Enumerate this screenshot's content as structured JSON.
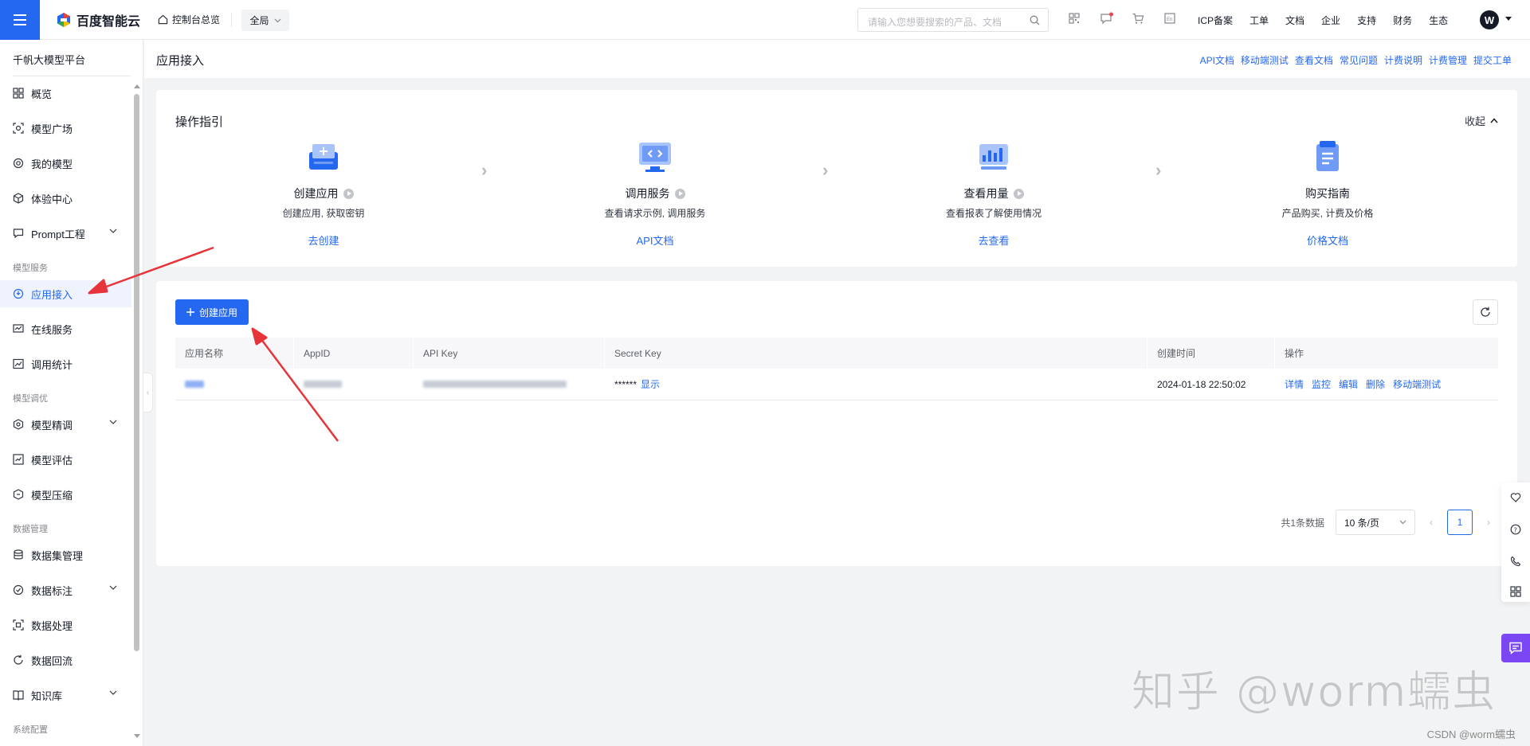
{
  "header": {
    "logo_text": "百度智能云",
    "console_home": "控制台总览",
    "region": "全局",
    "search_placeholder": "请输入您想要搜索的产品、文档",
    "links": [
      "ICP备案",
      "工单",
      "文档",
      "企业",
      "支持",
      "财务",
      "生态"
    ],
    "avatar_letter": "W",
    "brand_color": "#2468f2"
  },
  "sidebar": {
    "title": "千帆大模型平台",
    "items": [
      {
        "label": "概览",
        "icon": "grid-icon"
      },
      {
        "label": "模型广场",
        "icon": "model-square-icon"
      },
      {
        "label": "我的模型",
        "icon": "my-model-icon"
      },
      {
        "label": "体验中心",
        "icon": "cube-icon"
      },
      {
        "label": "Prompt工程",
        "icon": "prompt-icon"
      },
      {
        "label": "应用接入",
        "icon": "app-access-icon"
      },
      {
        "label": "在线服务",
        "icon": "online-service-icon"
      },
      {
        "label": "调用统计",
        "icon": "stats-icon"
      },
      {
        "label": "模型精调",
        "icon": "finetune-icon"
      },
      {
        "label": "模型评估",
        "icon": "evaluate-icon"
      },
      {
        "label": "模型压缩",
        "icon": "compress-icon"
      },
      {
        "label": "数据集管理",
        "icon": "database-icon"
      },
      {
        "label": "数据标注",
        "icon": "annotate-icon"
      },
      {
        "label": "数据处理",
        "icon": "process-icon"
      },
      {
        "label": "数据回流",
        "icon": "reflow-icon"
      },
      {
        "label": "知识库",
        "icon": "knowledge-icon"
      }
    ],
    "groups": [
      "模型服务",
      "模型调优",
      "数据管理",
      "系统配置"
    ]
  },
  "page": {
    "title": "应用接入",
    "head_links": [
      "API文档",
      "移动端测试",
      "查看文档",
      "常见问题",
      "计费说明",
      "计费管理",
      "提交工单"
    ]
  },
  "guide": {
    "title": "操作指引",
    "collapse": "收起",
    "steps": [
      {
        "name": "创建应用",
        "desc": "创建应用, 获取密钥",
        "link": "去创建"
      },
      {
        "name": "调用服务",
        "desc": "查看请求示例, 调用服务",
        "link": "API文档"
      },
      {
        "name": "查看用量",
        "desc": "查看报表了解使用情况",
        "link": "去查看"
      },
      {
        "name": "购买指南",
        "desc": "产品购买, 计费及价格",
        "link": "价格文档"
      }
    ]
  },
  "apps": {
    "create_label": "创建应用",
    "columns": [
      "应用名称",
      "AppID",
      "API Key",
      "Secret Key",
      "创建时间",
      "操作"
    ],
    "rows": [
      {
        "secret": "******",
        "show": "显示",
        "created": "2024-01-18 22:50:02",
        "ops": [
          "详情",
          "监控",
          "编辑",
          "删除",
          "移动端测试"
        ]
      }
    ],
    "total": "共1条数据",
    "page_size": "10 条/页",
    "current_page": "1"
  },
  "watermark": "知乎 @worm蠕虫",
  "csdn": "CSDN @worm蠕虫"
}
